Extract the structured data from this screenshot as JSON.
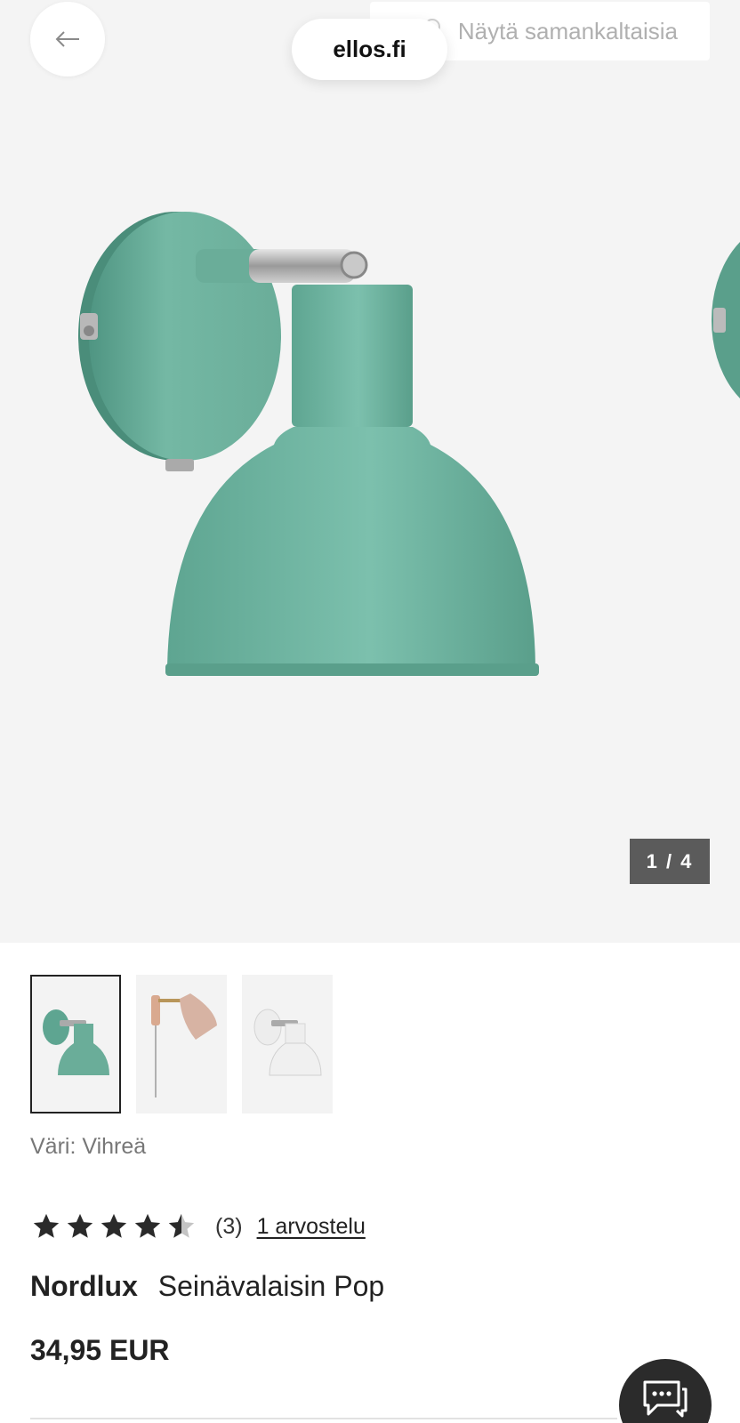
{
  "browser": {
    "url": "ellos.fi"
  },
  "header": {
    "similar_label": "Näytä samankaltaisia"
  },
  "gallery": {
    "counter": "1 / 4",
    "current": 1,
    "total": 4
  },
  "thumbnails": [
    {
      "name": "green",
      "selected": true
    },
    {
      "name": "beige",
      "selected": false
    },
    {
      "name": "white",
      "selected": false
    }
  ],
  "product": {
    "color_label": "Väri: Vihreä",
    "rating_value": 4.5,
    "rating_max": 5,
    "rating_count": "(3)",
    "reviews_link": "1 arvostelu",
    "brand": "Nordlux",
    "name": "Seinävalaisin Pop",
    "price": "34,95 EUR"
  },
  "icons": {
    "back": "arrow-left-icon",
    "similar": "similar-items-icon",
    "chat": "chat-bubble-icon",
    "star": "star-icon"
  },
  "colors": {
    "lamp_green": "#6fb3a0",
    "lamp_green_dark": "#4f9582",
    "hero_bg": "#f4f4f4",
    "counter_bg": "#5b5b5b",
    "chat_bg": "#2b2b2b"
  }
}
